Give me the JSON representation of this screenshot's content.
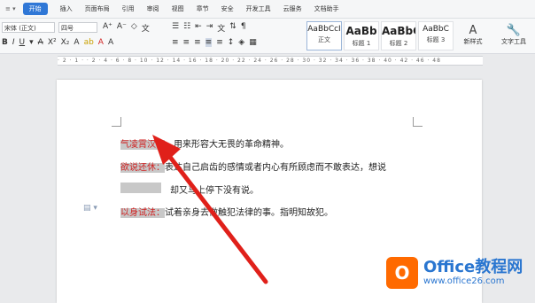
{
  "menu": {
    "items": [
      "开始",
      "插入",
      "页面布局",
      "引用",
      "审阅",
      "视图",
      "章节",
      "安全",
      "开发工具",
      "云服务",
      "文档助手"
    ]
  },
  "toolbar": {
    "font_name": "宋体 (正文)",
    "font_size": "四号",
    "styles": [
      {
        "sample": "AaBbCcI",
        "label": "正文"
      },
      {
        "sample": "AaBb",
        "label": "标题 1"
      },
      {
        "sample": "AaBbC",
        "label": "标题 2"
      },
      {
        "sample": "AaBbC",
        "label": "标题 3"
      }
    ],
    "new_style": "新样式",
    "text_tools": "文字工具"
  },
  "document": {
    "entries": [
      {
        "term": "气凌霄汉：",
        "definition": "用来形容大无畏的革命精神。"
      },
      {
        "term": "欲说还休：",
        "definition": "表达自己启齿的感情或者内心有所顾虑而不敢表达，想说",
        "continuation": "却又马上停下没有说。"
      },
      {
        "term": "以身试法：",
        "definition": "试着亲身去做触犯法律的事。指明知故犯。"
      }
    ]
  },
  "watermark": {
    "title": "Office教程网",
    "url": "www.office26.com"
  },
  "colors": {
    "accent": "#2f77d6",
    "term_text": "#d02020",
    "highlight": "#c8c8c8",
    "arrow": "#e0201a"
  }
}
